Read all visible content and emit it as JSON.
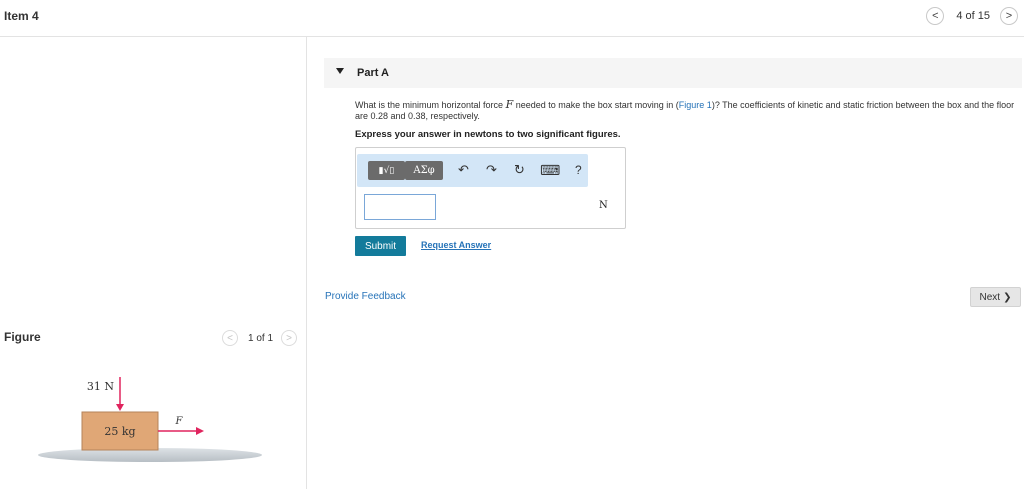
{
  "header": {
    "item_title": "Item 4",
    "pager_text": "4 of 15"
  },
  "figure_panel": {
    "label": "Figure",
    "pager_text": "1 of 1",
    "diagram": {
      "force_down_label": "31 N",
      "mass_label": "25 kg",
      "force_right_label": "F",
      "colors": {
        "arrow": "#e0245e",
        "box": "#e0a776",
        "box_border": "#b5835a",
        "floor": "#c8ced3"
      }
    }
  },
  "part": {
    "title": "Part A",
    "question_pre": "What is the minimum horizontal force ",
    "question_var": "F",
    "question_mid": " needed to make the box start moving in (",
    "question_link": "Figure 1",
    "question_post": ")? The coefficients of kinetic and static friction between the box and the floor are 0.28 and 0.38, respectively.",
    "instruction": "Express your answer in newtons to two significant figures.",
    "toolbar": {
      "templates_label": "▮√▯",
      "greek_label": "ΑΣφ",
      "undo_icon": "↶",
      "redo_icon": "↷",
      "reset_icon": "↻",
      "keyboard_icon": "⌨",
      "help_label": "?"
    },
    "answer_value": "",
    "unit": "N",
    "submit_label": "Submit",
    "request_answer_label": "Request Answer"
  },
  "footer": {
    "provide_feedback": "Provide Feedback",
    "next_label": "Next"
  },
  "colors": {
    "accent": "#137b9b",
    "link": "#2673b8"
  }
}
